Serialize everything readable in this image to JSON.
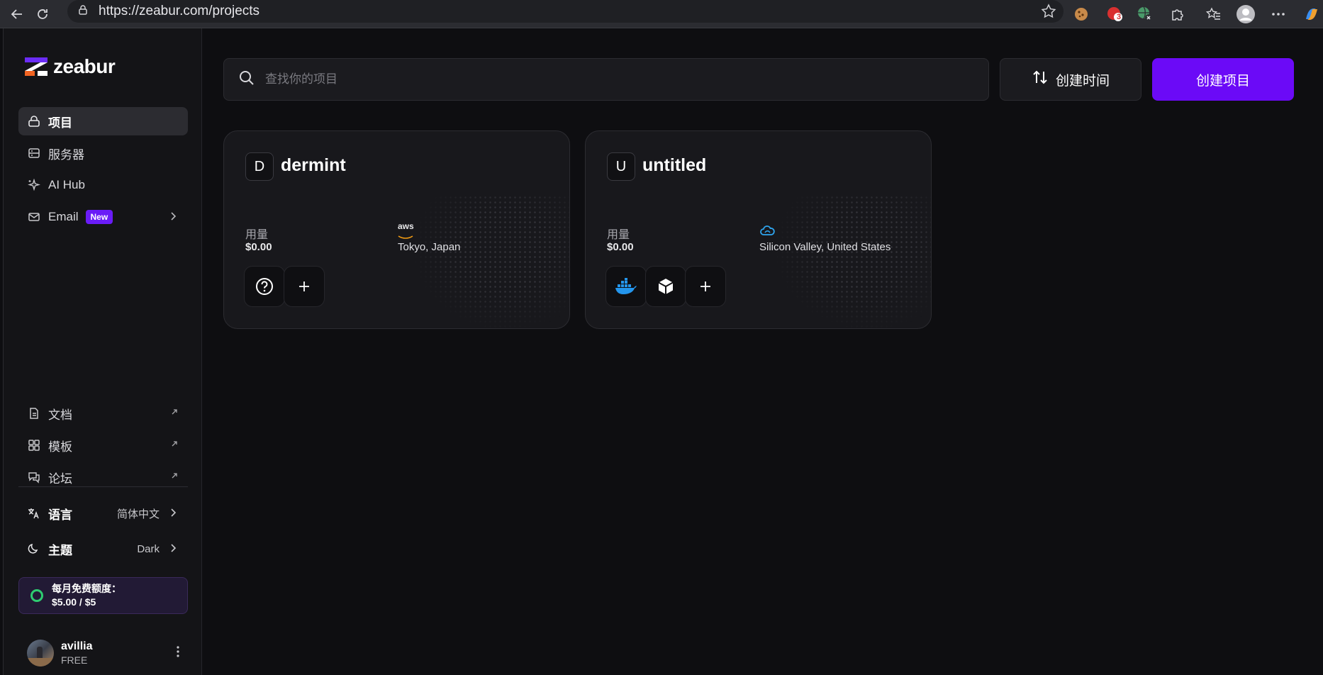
{
  "browser": {
    "url": "https://zeabur.com/projects",
    "extension_badge": "3"
  },
  "sidebar": {
    "logo_text": "zeabur",
    "nav": [
      {
        "label": "项目",
        "icon": "lock-icon"
      },
      {
        "label": "服务器",
        "icon": "server-icon"
      },
      {
        "label": "AI Hub",
        "icon": "sparkle-icon"
      },
      {
        "label": "Email",
        "icon": "mail-icon",
        "badge": "New"
      }
    ],
    "links": [
      {
        "label": "文档",
        "icon": "doc-icon"
      },
      {
        "label": "模板",
        "icon": "template-icon"
      },
      {
        "label": "论坛",
        "icon": "forum-icon"
      }
    ],
    "language": {
      "label": "语言",
      "value": "简体中文"
    },
    "theme": {
      "label": "主题",
      "value": "Dark"
    },
    "credit": {
      "line1": "每月免费额度：",
      "line2": "$5.00 / $5"
    },
    "user": {
      "name": "avillia",
      "plan": "FREE"
    }
  },
  "toolbar": {
    "search_placeholder": "查找你的项目",
    "sort_label": "创建时间",
    "create_label": "创建项目"
  },
  "projects": [
    {
      "letter": "D",
      "name": "dermint",
      "usage_label": "用量",
      "usage": "$0.00",
      "provider": "aws",
      "region": "Tokyo, Japan"
    },
    {
      "letter": "U",
      "name": "untitled",
      "usage_label": "用量",
      "usage": "$0.00",
      "provider": "cloud",
      "region": "Silicon Valley, United States"
    }
  ],
  "colors": {
    "accent": "#6b0af7",
    "background": "#0e0e11",
    "sidebar": "#141417",
    "credit_ring": "#2ecc71"
  }
}
